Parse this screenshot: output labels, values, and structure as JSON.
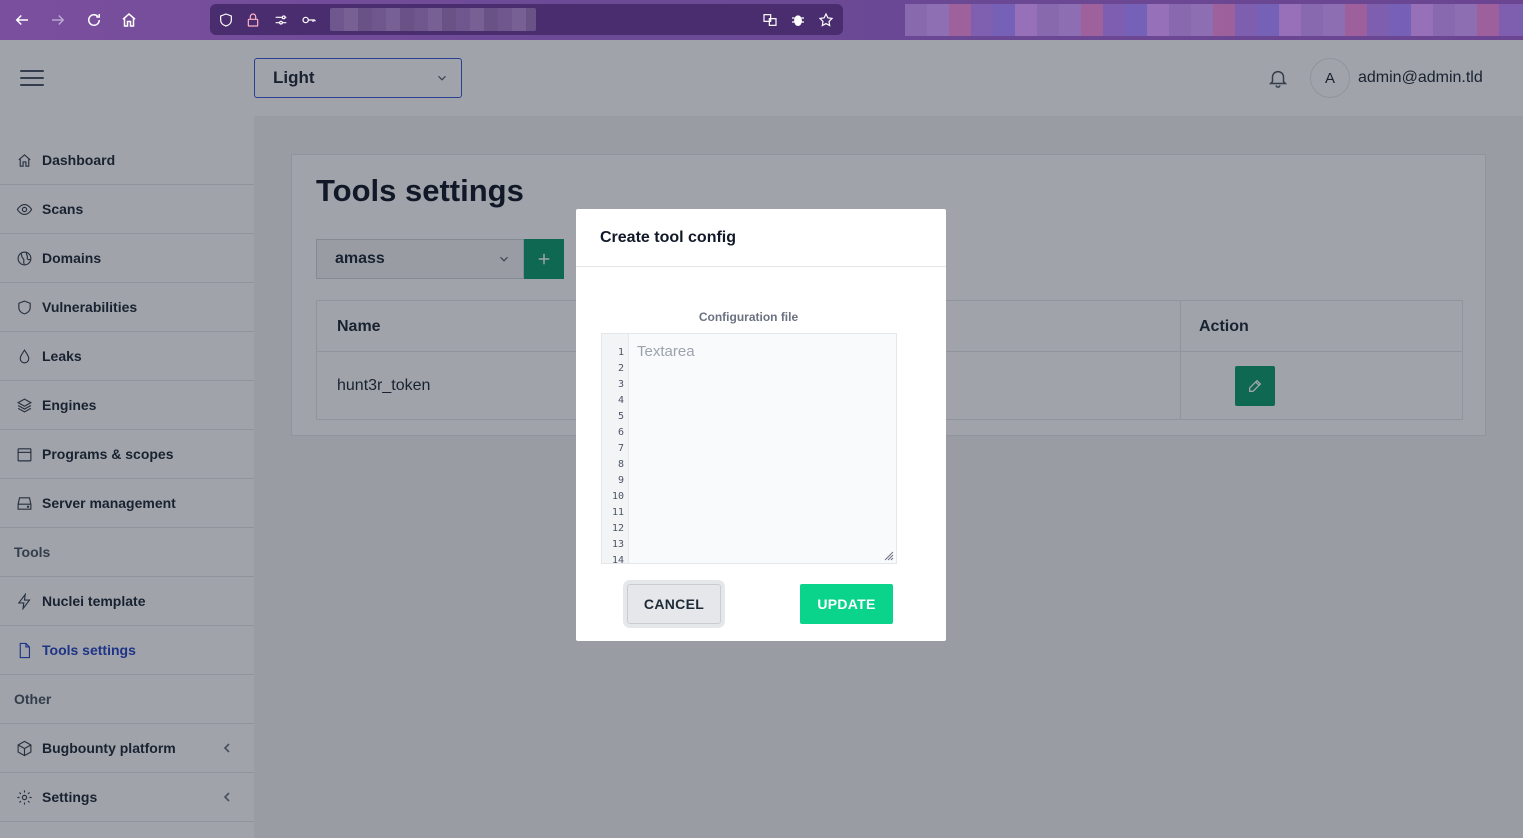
{
  "header": {
    "theme_value": "Light",
    "avatar_initial": "A",
    "user_email": "admin@admin.tld"
  },
  "sidebar": {
    "items": [
      {
        "label": "Dashboard",
        "icon": "home-icon"
      },
      {
        "label": "Scans",
        "icon": "eye-icon"
      },
      {
        "label": "Domains",
        "icon": "globe-icon"
      },
      {
        "label": "Vulnerabilities",
        "icon": "shield-icon"
      },
      {
        "label": "Leaks",
        "icon": "drop-icon"
      },
      {
        "label": "Engines",
        "icon": "layers-icon"
      },
      {
        "label": "Programs & scopes",
        "icon": "calendar-icon"
      },
      {
        "label": "Server management",
        "icon": "server-icon"
      }
    ],
    "section_tools": "Tools",
    "tools_items": [
      {
        "label": "Nuclei template",
        "icon": "lightning-icon"
      },
      {
        "label": "Tools settings",
        "icon": "document-icon",
        "active": true
      }
    ],
    "section_other": "Other",
    "other_items": [
      {
        "label": "Bugbounty platform",
        "icon": "cube-icon"
      },
      {
        "label": "Settings",
        "icon": "gear-icon"
      }
    ]
  },
  "main": {
    "title": "Tools settings",
    "tool_select_value": "amass",
    "table": {
      "headers": [
        "Name",
        "Action"
      ],
      "rows": [
        {
          "name": "hunt3r_token"
        }
      ]
    }
  },
  "modal": {
    "title": "Create tool config",
    "field_label": "Configuration file",
    "placeholder": "Textarea",
    "line_numbers": [
      "1",
      "2",
      "3",
      "4",
      "5",
      "6",
      "7",
      "8",
      "9",
      "10",
      "11",
      "12",
      "13",
      "14"
    ],
    "cancel_label": "CANCEL",
    "update_label": "UPDATE"
  },
  "colors": {
    "accent_blue": "#2946c7",
    "green": "#0e9f6e",
    "update_green": "#0ad48b",
    "browser_purple": "#6b4a96"
  }
}
